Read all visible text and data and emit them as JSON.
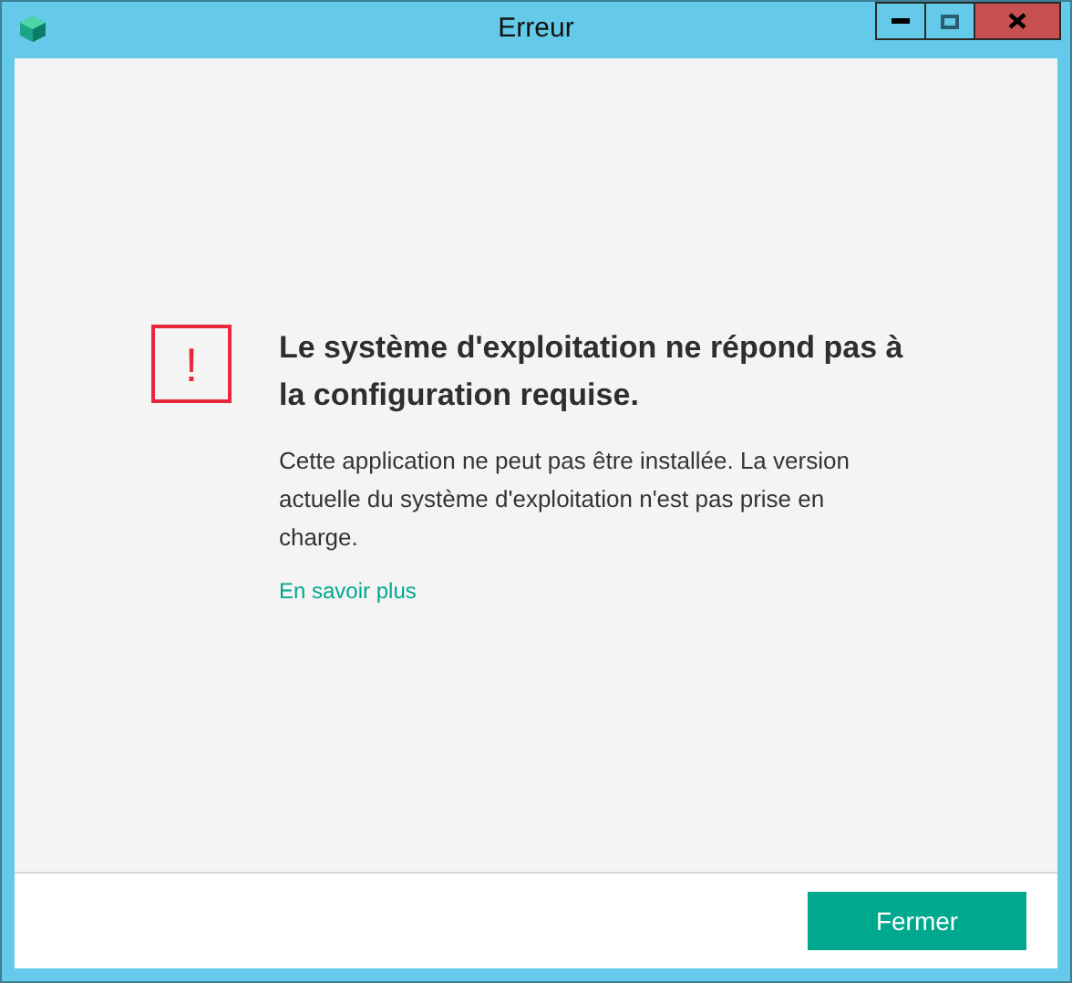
{
  "window": {
    "title": "Erreur"
  },
  "message": {
    "icon_text": "!",
    "heading": "Le système d'exploitation ne répond pas à la configuration requise.",
    "body": "Cette application ne peut pas être installée. La version actuelle du système d'exploitation n'est pas prise en charge.",
    "link": "En savoir plus"
  },
  "buttons": [
    "Fermer"
  ]
}
